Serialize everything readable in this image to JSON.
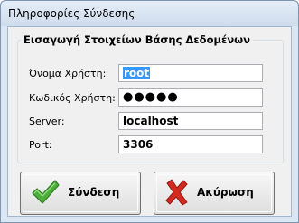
{
  "window": {
    "title": "Πληροφορίες Σύνδεσης"
  },
  "group": {
    "title": "Εισαγωγή Στοιχείων Βάσης Δεδομένων"
  },
  "fields": [
    {
      "label": "Όνομα Χρήστη:",
      "value": "root"
    },
    {
      "label": "Κωδικός Χρήστη:",
      "value": "●●●●●"
    },
    {
      "label": "Server:",
      "value": "localhost"
    },
    {
      "label": "Port:",
      "value": "3306"
    }
  ],
  "buttons": {
    "connect_label": "Σύνδεση",
    "cancel_label": "Ακύρωση"
  },
  "icons": {
    "connect": "checkmark-icon",
    "cancel": "cross-icon"
  },
  "colors": {
    "selection": "#3399ff",
    "check": "#4caf3a",
    "cross": "#d42a1f"
  }
}
